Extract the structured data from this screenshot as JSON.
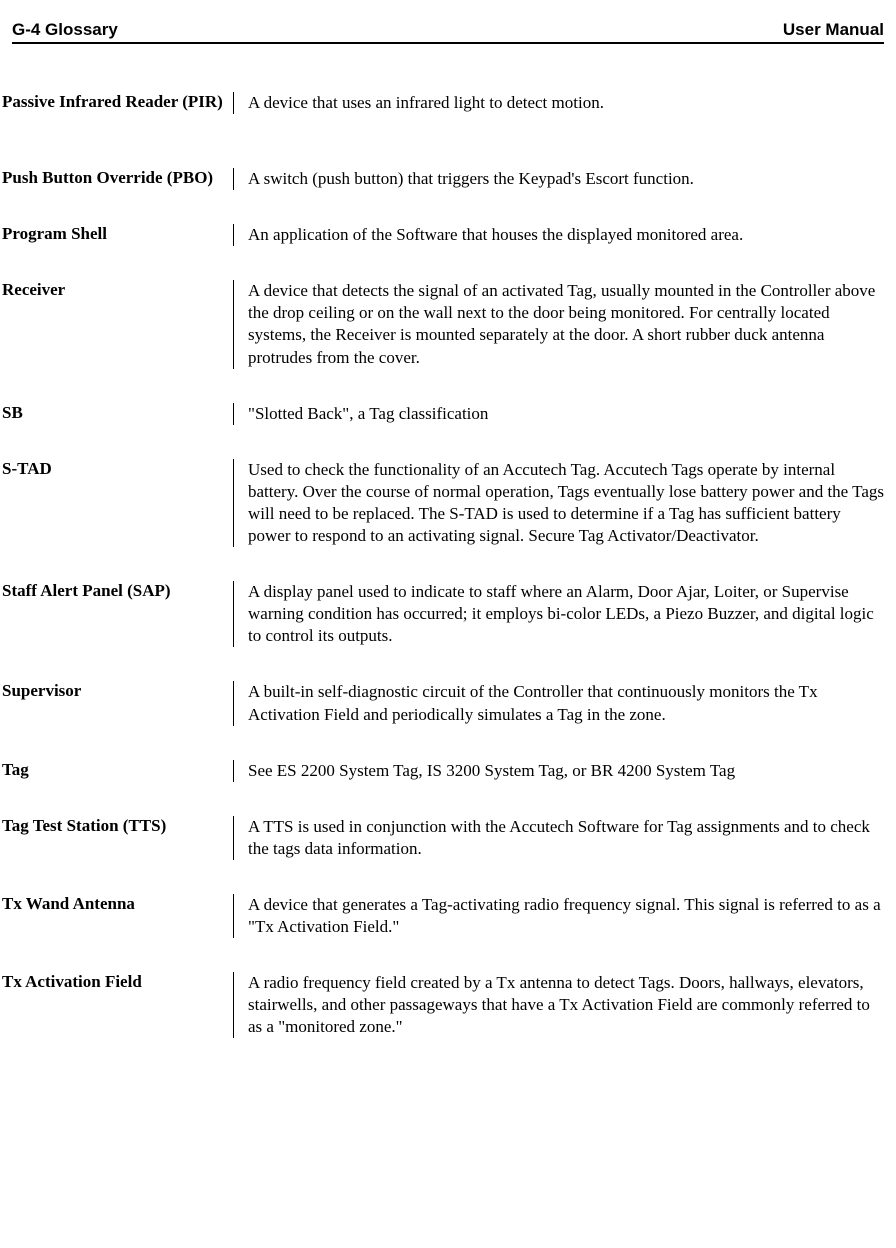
{
  "header": {
    "left": "G-4 Glossary",
    "right": "User Manual"
  },
  "entries": [
    {
      "term": "Passive Infrared Reader (PIR)",
      "def": "A device that uses an infrared light to detect motion."
    },
    {
      "term": "Push Button Override (PBO)",
      "def": "A switch (push button) that triggers the Keypad's Escort function."
    },
    {
      "term": "Program Shell",
      "def": "An application of the Software that houses the displayed monitored area."
    },
    {
      "term": "Receiver",
      "def": "A device that detects the signal of an activated Tag, usually mounted in the Controller above the drop ceiling or on the wall next to the door being monitored. For centrally located systems, the Receiver is mounted separately at the door. A short rubber duck antenna protrudes from the cover."
    },
    {
      "term": "SB",
      "def": "\"Slotted Back\", a Tag classification"
    },
    {
      "term": "S-TAD",
      "def": "Used to check the functionality of an Accutech Tag. Accutech Tags operate by internal battery. Over the course of normal operation, Tags eventually lose battery power and the Tags will need to be replaced. The S-TAD is used to determine if a Tag has sufficient battery power to respond to an activating signal. Secure Tag Activator/Deactivator."
    },
    {
      "term": "Staff Alert Panel (SAP)",
      "def": "A display panel used to indicate to staff where an Alarm, Door Ajar, Loiter, or Supervise warning condition has occurred; it employs bi-color LEDs, a Piezo Buzzer, and digital logic to control its outputs."
    },
    {
      "term": "Supervisor",
      "def": "A built-in self-diagnostic circuit of the Controller that continuously monitors the Tx Activation Field and periodically simulates a Tag in the zone."
    },
    {
      "term": "Tag",
      "def": "See ES 2200 System Tag, IS 3200 System Tag, or BR 4200 System Tag"
    },
    {
      "term": "Tag Test Station (TTS)",
      "def": "A TTS is used in conjunction with the Accutech Software for Tag assignments and to check the tags data information."
    },
    {
      "term": "Tx Wand Antenna",
      "def": "A device that generates a Tag-activating radio frequency signal. This signal is referred to as a \"Tx Activation Field.\""
    },
    {
      "term": "Tx Activation Field",
      "def": "A radio frequency field created by a Tx antenna to detect Tags. Doors, hallways, elevators, stairwells, and other passageways that have a Tx Activation Field are commonly referred to as a \"monitored zone.\""
    }
  ]
}
